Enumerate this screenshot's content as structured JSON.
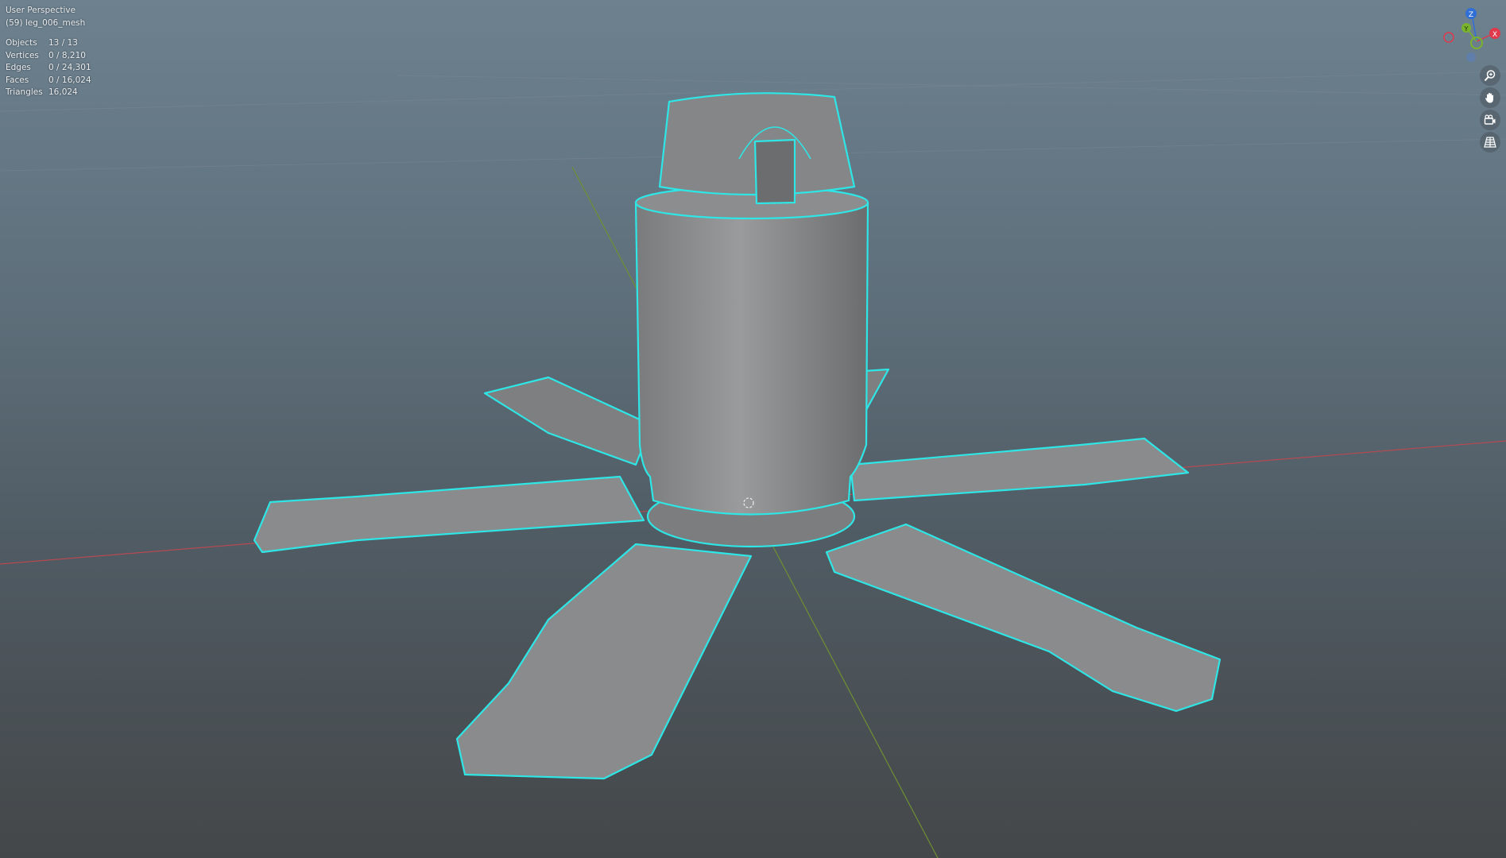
{
  "viewport": {
    "view_name": "User Perspective",
    "object_name": "(59) leg_006_mesh",
    "stats": [
      {
        "label": "Objects",
        "value": "13 / 13"
      },
      {
        "label": "Vertices",
        "value": "0 / 8,210"
      },
      {
        "label": "Edges",
        "value": "0 / 24,301"
      },
      {
        "label": "Faces",
        "value": "0 / 16,024"
      },
      {
        "label": "Triangles",
        "value": "16,024"
      }
    ]
  },
  "gizmo": {
    "x_label": "X",
    "y_label": "Y",
    "z_label": "Z",
    "x_color": "#e0394c",
    "y_color": "#7ab32e",
    "z_color": "#2f6fd6"
  },
  "navigation": {
    "buttons": [
      "zoom-icon",
      "pan-hand-icon",
      "camera-icon",
      "grid-icon"
    ]
  },
  "colors": {
    "selection_outline": "#2ee6e6",
    "mesh": "#8a8b8c"
  }
}
